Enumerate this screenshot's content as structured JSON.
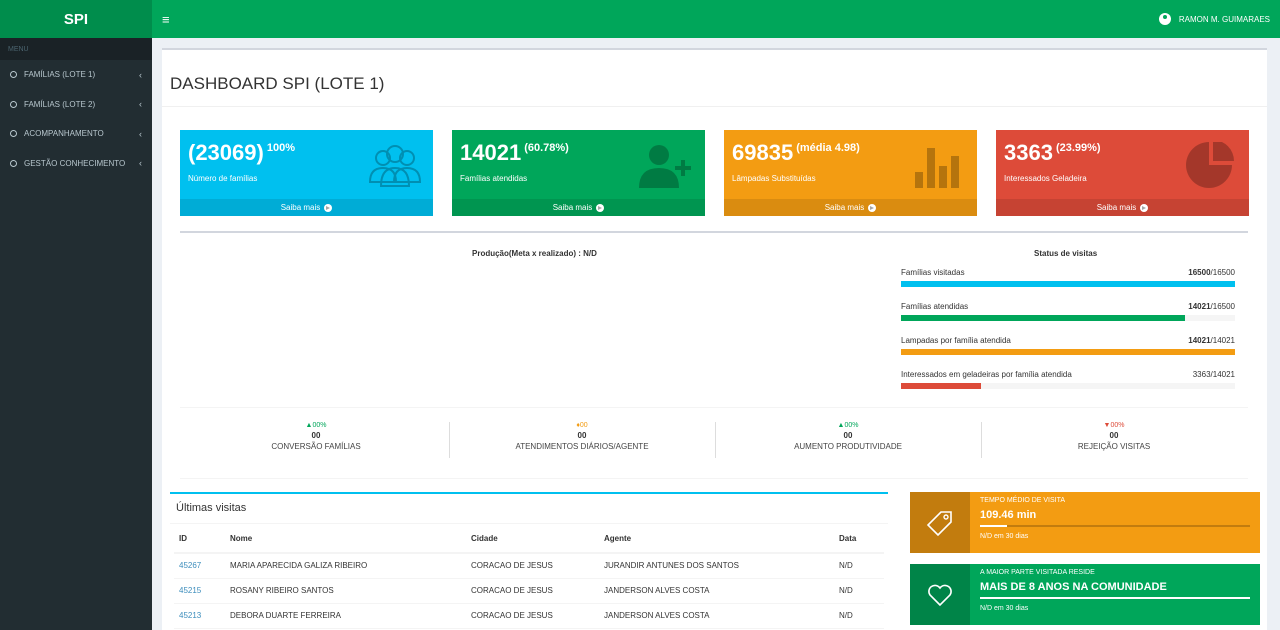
{
  "app": {
    "logo": "SPI"
  },
  "header": {
    "menu_icon": "≡",
    "user_name": "RAMON M. GUIMARAES"
  },
  "sidebar": {
    "header": "MENU",
    "items": [
      {
        "label": "FAMÍLIAS (LOTE 1)"
      },
      {
        "label": "FAMÍLIAS (LOTE 2)"
      },
      {
        "label": "ACOMPANHAMENTO"
      },
      {
        "label": "GESTÃO CONHECIMENTO"
      }
    ],
    "chevron": "‹"
  },
  "page": {
    "title": "DASHBOARD SPI (LOTE 1)"
  },
  "boxes": [
    {
      "number": "(23069)",
      "sup": "100%",
      "label": "Número de famílias",
      "link": "Saiba mais",
      "color": "#00c0ef",
      "icon": "users-icon"
    },
    {
      "number": "14021",
      "sup": "(60.78%)",
      "label": "Famílias atendidas",
      "link": "Saiba mais",
      "color": "#00a65a",
      "icon": "user-plus-icon"
    },
    {
      "number": "69835",
      "sup": "(média 4.98)",
      "label": "Lâmpadas Substituídas",
      "link": "Saiba mais",
      "color": "#f39c12",
      "icon": "bar-chart-icon"
    },
    {
      "number": "3363",
      "sup": "(23.99%)",
      "label": "Interessados Geladeira",
      "link": "Saiba mais",
      "color": "#dd4b39",
      "icon": "pie-chart-icon"
    }
  ],
  "production": {
    "title": "Produção(Meta x realizado) : N/D"
  },
  "status": {
    "title": "Status de visitas",
    "items": [
      {
        "label": "Famílias visitadas",
        "value": "16500",
        "total": "/16500",
        "fraction": 1.0,
        "color": "#00c0ef"
      },
      {
        "label": "Famílias atendidas",
        "value": "14021",
        "total": "/16500",
        "fraction": 0.85,
        "color": "#00a65a"
      },
      {
        "label": "Lampadas por família atendida",
        "value": "14021",
        "total": "/14021",
        "fraction": 1.0,
        "color": "#f39c12"
      },
      {
        "label": "Interessados em geladeiras por família atendida",
        "value": "3363",
        "total": "/14021",
        "fraction": 0.24,
        "color": "#dd4b39"
      }
    ]
  },
  "kpis": [
    {
      "pct": "▲00%",
      "value": "00",
      "label": "CONVERSÃO FAMÍLIAS",
      "color": "#00a65a"
    },
    {
      "pct": "♦00",
      "value": "00",
      "label": "ATENDIMENTOS DIÁRIOS/AGENTE",
      "color": "#f39c12"
    },
    {
      "pct": "▲00%",
      "value": "00",
      "label": "AUMENTO PRODUTIVIDADE",
      "color": "#00a65a"
    },
    {
      "pct": "▼00%",
      "value": "00",
      "label": "REJEIÇÃO VISITAS",
      "color": "#dd4b39"
    }
  ],
  "visits": {
    "title": "Últimas visitas",
    "columns": [
      "ID",
      "Nome",
      "Cidade",
      "Agente",
      "Data"
    ],
    "rows": [
      [
        "45267",
        "MARIA APARECIDA GALIZA RIBEIRO",
        "CORACAO DE JESUS",
        "JURANDIR ANTUNES DOS SANTOS",
        "N/D"
      ],
      [
        "45215",
        "ROSANY RIBEIRO SANTOS",
        "CORACAO DE JESUS",
        "JANDERSON ALVES COSTA",
        "N/D"
      ],
      [
        "45213",
        "DEBORA DUARTE FERREIRA",
        "CORACAO DE JESUS",
        "JANDERSON ALVES COSTA",
        "N/D"
      ]
    ]
  },
  "info_boxes": [
    {
      "title": "TEMPO MÉDIO DE VISITA",
      "value": "109.46 min",
      "footer": "N/D em 30 dias",
      "progress": 0.1,
      "color": "#f39c12",
      "icon": "tag-icon"
    },
    {
      "title": "A MAIOR PARTE VISITADA RESIDE",
      "value": "MAIS DE 8 ANOS NA COMUNIDADE",
      "footer": "N/D em 30 dias",
      "progress": 1.0,
      "color": "#00a65a",
      "icon": "heart-icon"
    }
  ]
}
